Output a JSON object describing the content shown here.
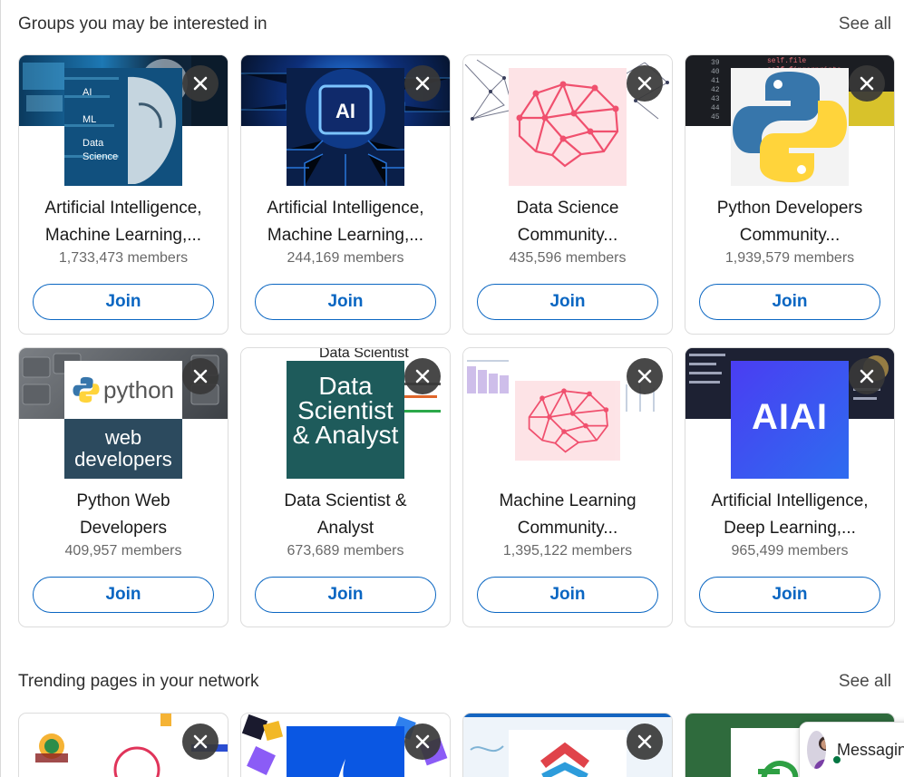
{
  "groups_section": {
    "title": "Groups you may be interested in",
    "see_all": "See all",
    "cards": [
      {
        "name_line1": "Artificial Intelligence,",
        "name_line2": "Machine Learning,...",
        "members": "1,733,473 members",
        "join": "Join",
        "logo_icon": "ai-ml-data-science-logo"
      },
      {
        "name_line1": "Artificial Intelligence,",
        "name_line2": "Machine Learning,...",
        "members": "244,169 members",
        "join": "Join",
        "logo_icon": "ai-chip-logo",
        "logo_text": "AI"
      },
      {
        "name_line1": "Data Science",
        "name_line2": "Community...",
        "members": "435,596 members",
        "join": "Join",
        "logo_icon": "brain-network-logo"
      },
      {
        "name_line1": "Python Developers",
        "name_line2": "Community...",
        "members": "1,939,579 members",
        "join": "Join",
        "logo_icon": "python-logo"
      },
      {
        "name_line1": "Python Web",
        "name_line2": "Developers",
        "members": "409,957 members",
        "join": "Join",
        "logo_icon": "python-web-developers-logo",
        "logo_line1": "python",
        "logo_line2": "web",
        "logo_line3": "developers"
      },
      {
        "name_line1": "Data Scientist &",
        "name_line2": "Analyst",
        "members": "673,689 members",
        "join": "Join",
        "logo_icon": "data-scientist-analyst-logo",
        "logo_line1": "Data",
        "logo_line2": "Scientist",
        "logo_line3": "& Analyst",
        "banner_text": "Data Scientist"
      },
      {
        "name_line1": "Machine Learning",
        "name_line2": "Community...",
        "members": "1,395,122 members",
        "join": "Join",
        "logo_icon": "brain-network-logo"
      },
      {
        "name_line1": "Artificial Intelligence,",
        "name_line2": "Deep Learning,...",
        "members": "965,499 members",
        "join": "Join",
        "logo_icon": "aiai-logo",
        "logo_text": "AIAI"
      }
    ]
  },
  "trending_section": {
    "title": "Trending pages in your network",
    "see_all": "See all"
  },
  "messaging": {
    "label": "Messaging"
  },
  "colors": {
    "brand_blue": "#0a66c2",
    "dismiss_bg": "#383838",
    "online_green": "#057642"
  }
}
